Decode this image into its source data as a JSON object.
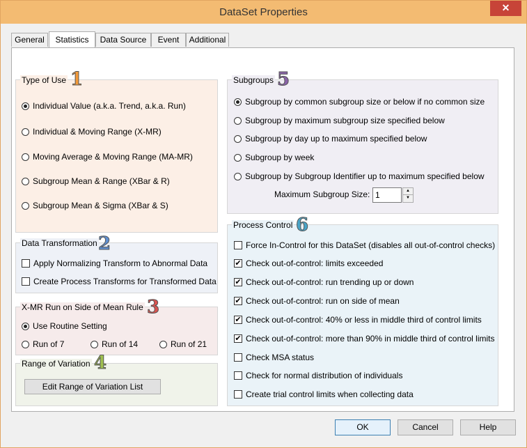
{
  "window": {
    "title": "DataSet Properties",
    "close_glyph": "✕"
  },
  "tabs": [
    "General",
    "Statistics",
    "Data Source",
    "Event",
    "Additional"
  ],
  "type_of_use": {
    "title": "Type of Use",
    "number": "1",
    "number_color": "#f49b3a",
    "options": [
      "Individual Value (a.k.a. Trend, a.k.a. Run)",
      "Individual & Moving Range (X-MR)",
      "Moving Average & Moving Range (MA-MR)",
      "Subgroup Mean & Range (XBar & R)",
      "Subgroup Mean & Sigma (XBar & S)"
    ],
    "selected_index": 0,
    "bg": "#fcefe6"
  },
  "data_transformation": {
    "title": "Data Transformation",
    "number": "2",
    "number_color": "#5f8fd0",
    "options": [
      "Apply Normalizing Transform to Abnormal Data",
      "Create Process Transforms for Transformed Data"
    ],
    "bg": "#eef1f7"
  },
  "xmr_run": {
    "title": "X-MR Run on Side of Mean Rule",
    "number": "3",
    "number_color": "#d9534f",
    "routine": "Use Routine Setting",
    "runs": [
      "Run of 7",
      "Run of 14",
      "Run of 21"
    ],
    "bg": "#f6ebeb"
  },
  "range_of_variation": {
    "title": "Range of Variation",
    "number": "4",
    "number_color": "#a0c050",
    "button": "Edit Range of Variation List",
    "bg": "#f0f3ea"
  },
  "subgroups": {
    "title": "Subgroups",
    "number": "5",
    "number_color": "#8a63a8",
    "options": [
      "Subgroup by common subgroup size or below if no common size",
      "Subgroup by maximum subgroup size specified below",
      "Subgroup by day up to maximum specified below",
      "Subgroup by week",
      "Subgroup by Subgroup Identifier up to maximum specified below"
    ],
    "selected_index": 0,
    "max_label": "Maximum Subgroup Size:",
    "max_value": "1",
    "bg": "#f0eef4"
  },
  "process_control": {
    "title": "Process Control",
    "number": "6",
    "number_color": "#4aa5c8",
    "options": [
      {
        "label": "Force In-Control for this DataSet  (disables all out-of-control checks)",
        "checked": false
      },
      {
        "label": "Check out-of-control:  limits exceeded",
        "checked": true
      },
      {
        "label": "Check out-of-control:  run trending up or down",
        "checked": true
      },
      {
        "label": "Check out-of-control:  run on side of mean",
        "checked": true
      },
      {
        "label": "Check out-of-control:  40% or less in middle third of control limits",
        "checked": true
      },
      {
        "label": "Check out-of-control:  more than 90% in middle third of control limits",
        "checked": true
      },
      {
        "label": "Check MSA status",
        "checked": false
      },
      {
        "label": "Check for normal distribution of individuals",
        "checked": false
      },
      {
        "label": "Create trial control limits when collecting data",
        "checked": false
      }
    ],
    "check_glyph": "✔",
    "bg": "#eaf3f8"
  },
  "footer": {
    "ok": "OK",
    "cancel": "Cancel",
    "help": "Help"
  }
}
